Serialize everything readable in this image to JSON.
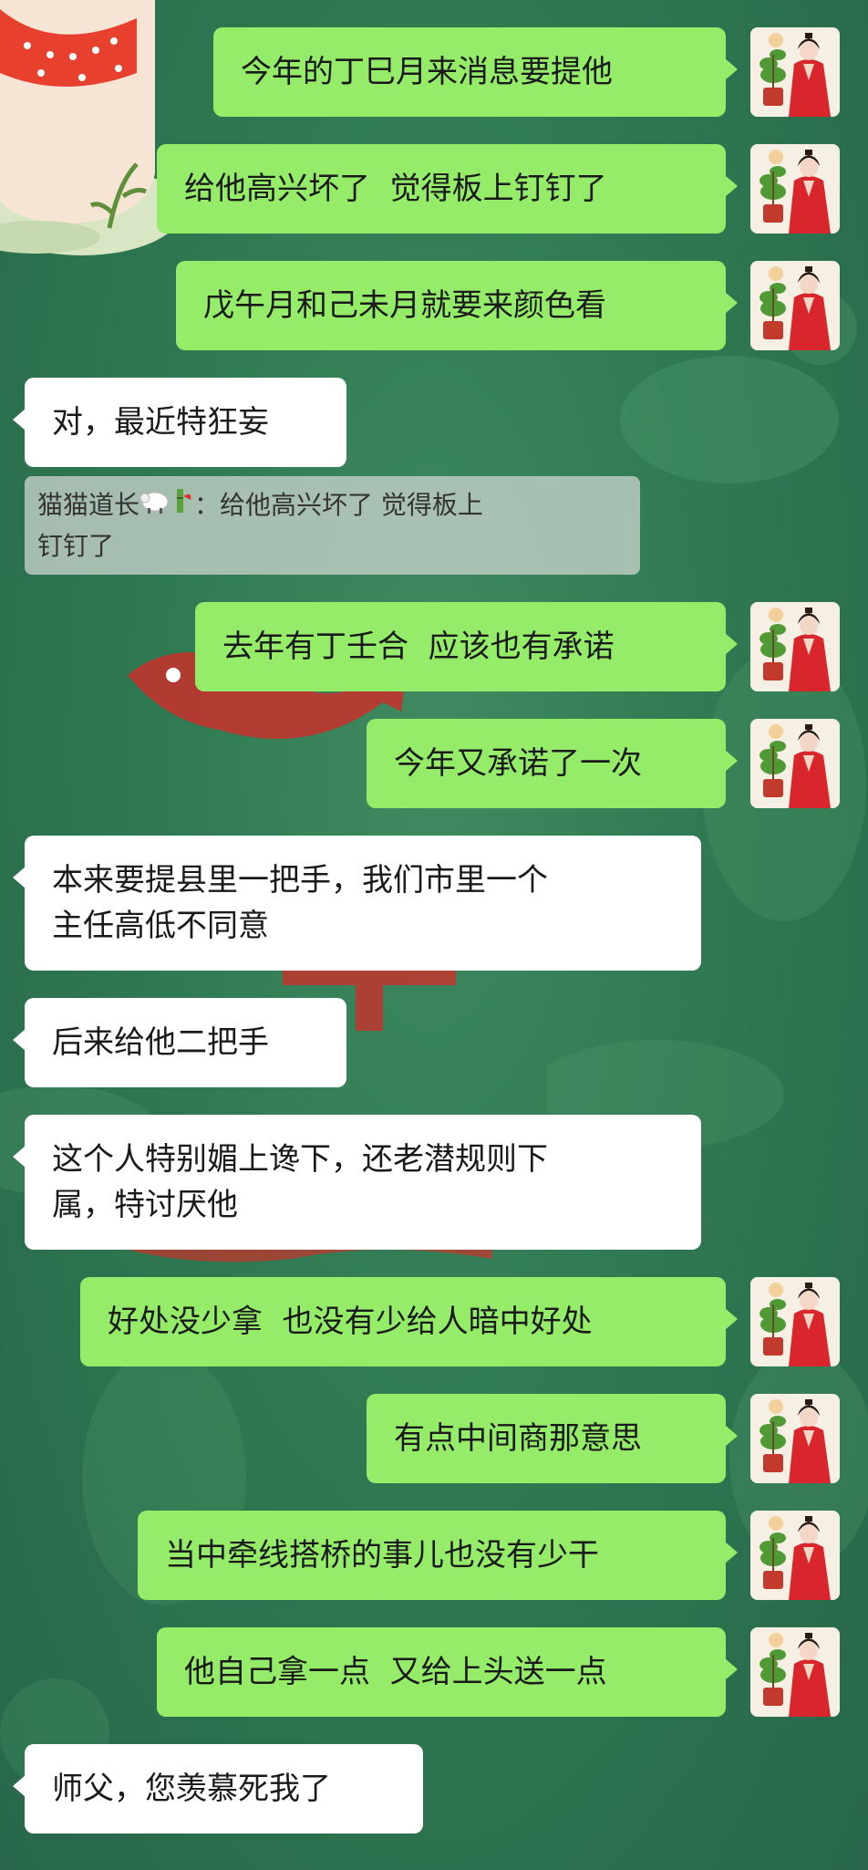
{
  "chat": {
    "messages": [
      {
        "side": "sent",
        "text": "今年的丁巳月来消息要提他"
      },
      {
        "side": "sent",
        "text": "给他高兴坏了  觉得板上钉钉了"
      },
      {
        "side": "sent",
        "text": "戊午月和己未月就要来颜色看"
      },
      {
        "side": "recv",
        "text": "对，最近特狂妄"
      },
      {
        "side": "sent",
        "text": "去年有丁壬合  应该也有承诺"
      },
      {
        "side": "sent",
        "text": "今年又承诺了一次"
      },
      {
        "side": "recv",
        "text": "本来要提县里一把手，我们市里一个\n主任高低不同意"
      },
      {
        "side": "recv",
        "text": "后来给他二把手"
      },
      {
        "side": "recv",
        "text": "这个人特别媚上谗下，还老潜规则下\n属，特讨厌他"
      },
      {
        "side": "sent",
        "text": "好处没少拿  也没有少给人暗中好处"
      },
      {
        "side": "sent",
        "text": "有点中间商那意思"
      },
      {
        "side": "sent",
        "text": "当中牵线搭桥的事儿也没有少干"
      },
      {
        "side": "sent",
        "text": "他自己拿一点  又给上头送一点"
      },
      {
        "side": "recv",
        "text": "师父，您羡慕死我了"
      }
    ],
    "quote": {
      "sender": "猫猫道长",
      "emojis": [
        "sheep-emoji",
        "bamboo-emoji"
      ],
      "separator": "：",
      "text_line1": "给他高兴坏了  觉得板上",
      "text_line2": "钉钉了"
    },
    "avatar": {
      "icon": "woman-in-red-hanfu-avatar",
      "colors": {
        "robe": "#d8262c",
        "plant": "#4f9a34",
        "pot": "#c23a2c",
        "background": "#f5efe4"
      }
    }
  },
  "colors": {
    "sent_bubble": "#95ec69",
    "received_bubble": "#ffffff",
    "chat_background": "#2f7a52",
    "text": "#1a1a1a"
  }
}
